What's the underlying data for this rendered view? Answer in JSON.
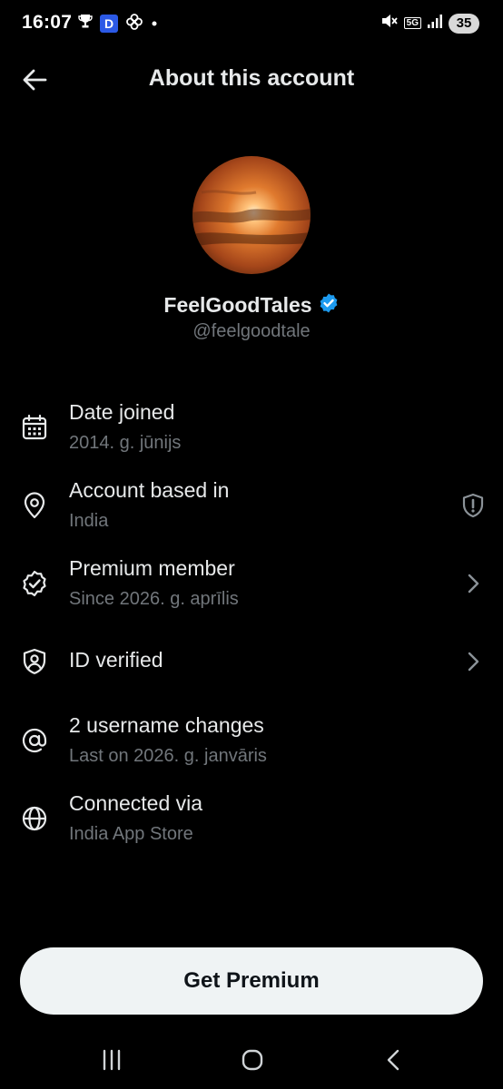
{
  "status_bar": {
    "time": "16:07",
    "d_badge": "D",
    "network": "5G",
    "battery": "35"
  },
  "header": {
    "title": "About this account"
  },
  "profile": {
    "display_name": "FeelGoodTales",
    "username": "@feelgoodtale",
    "verified": true
  },
  "info_rows": [
    {
      "icon": "calendar-icon",
      "title": "Date joined",
      "subtitle": "2014. g. jūnijs"
    },
    {
      "icon": "location-pin-icon",
      "title": "Account based in",
      "subtitle": "India",
      "trailing": "shield-alert-icon"
    },
    {
      "icon": "verified-badge-icon",
      "title": "Premium member",
      "subtitle": "Since 2026. g. aprīlis",
      "trailing": "chevron-right-icon"
    },
    {
      "icon": "id-shield-icon",
      "title": "ID verified",
      "trailing": "chevron-right-icon"
    },
    {
      "icon": "at-sign-icon",
      "title": "2 username changes",
      "subtitle": "Last on 2026. g. janvāris"
    },
    {
      "icon": "globe-icon",
      "title": "Connected via",
      "subtitle": "India App Store"
    }
  ],
  "cta": {
    "label": "Get Premium"
  },
  "colors": {
    "background": "#000000",
    "primary_text": "#e7e9ea",
    "secondary_text": "#71767b",
    "verified_blue": "#1d9bf0",
    "button_bg": "#eff3f4"
  }
}
